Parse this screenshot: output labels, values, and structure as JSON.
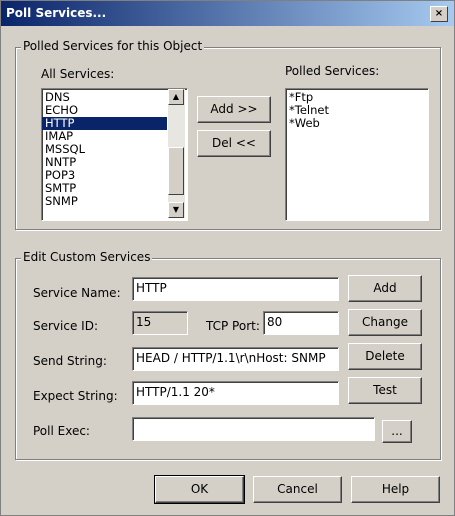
{
  "window": {
    "title": "Poll Services...",
    "close_glyph": "×"
  },
  "polled_group": {
    "legend": "Polled Services for this Object",
    "all_label": "All Services:",
    "polled_label": "Polled Services:",
    "all_services": [
      "DNS",
      "ECHO",
      "HTTP",
      "IMAP",
      "MSSQL",
      "NNTP",
      "POP3",
      "SMTP",
      "SNMP"
    ],
    "selected": "HTTP",
    "polled_services": [
      "*Ftp",
      "*Telnet",
      "*Web"
    ],
    "add_btn": "Add >>",
    "del_btn": "Del <<"
  },
  "edit_group": {
    "legend": "Edit Custom Services",
    "service_name_label": "Service Name:",
    "service_name_value": "HTTP",
    "service_id_label": "Service ID:",
    "service_id_value": "15",
    "tcp_port_label": "TCP Port:",
    "tcp_port_value": "80",
    "send_label": "Send String:",
    "send_value": "HEAD / HTTP/1.1\\r\\nHost: SNMP",
    "expect_label": "Expect String:",
    "expect_value": "HTTP/1.1 20*",
    "poll_exec_label": "Poll Exec:",
    "poll_exec_value": "",
    "browse_btn": "...",
    "add_btn": "Add",
    "change_btn": "Change",
    "delete_btn": "Delete",
    "test_btn": "Test"
  },
  "footer": {
    "ok": "OK",
    "cancel": "Cancel",
    "help": "Help"
  },
  "colors": {
    "title_start": "#0a246a",
    "title_end": "#a6caf0",
    "face": "#d4d0c8",
    "selection": "#0a246a"
  }
}
